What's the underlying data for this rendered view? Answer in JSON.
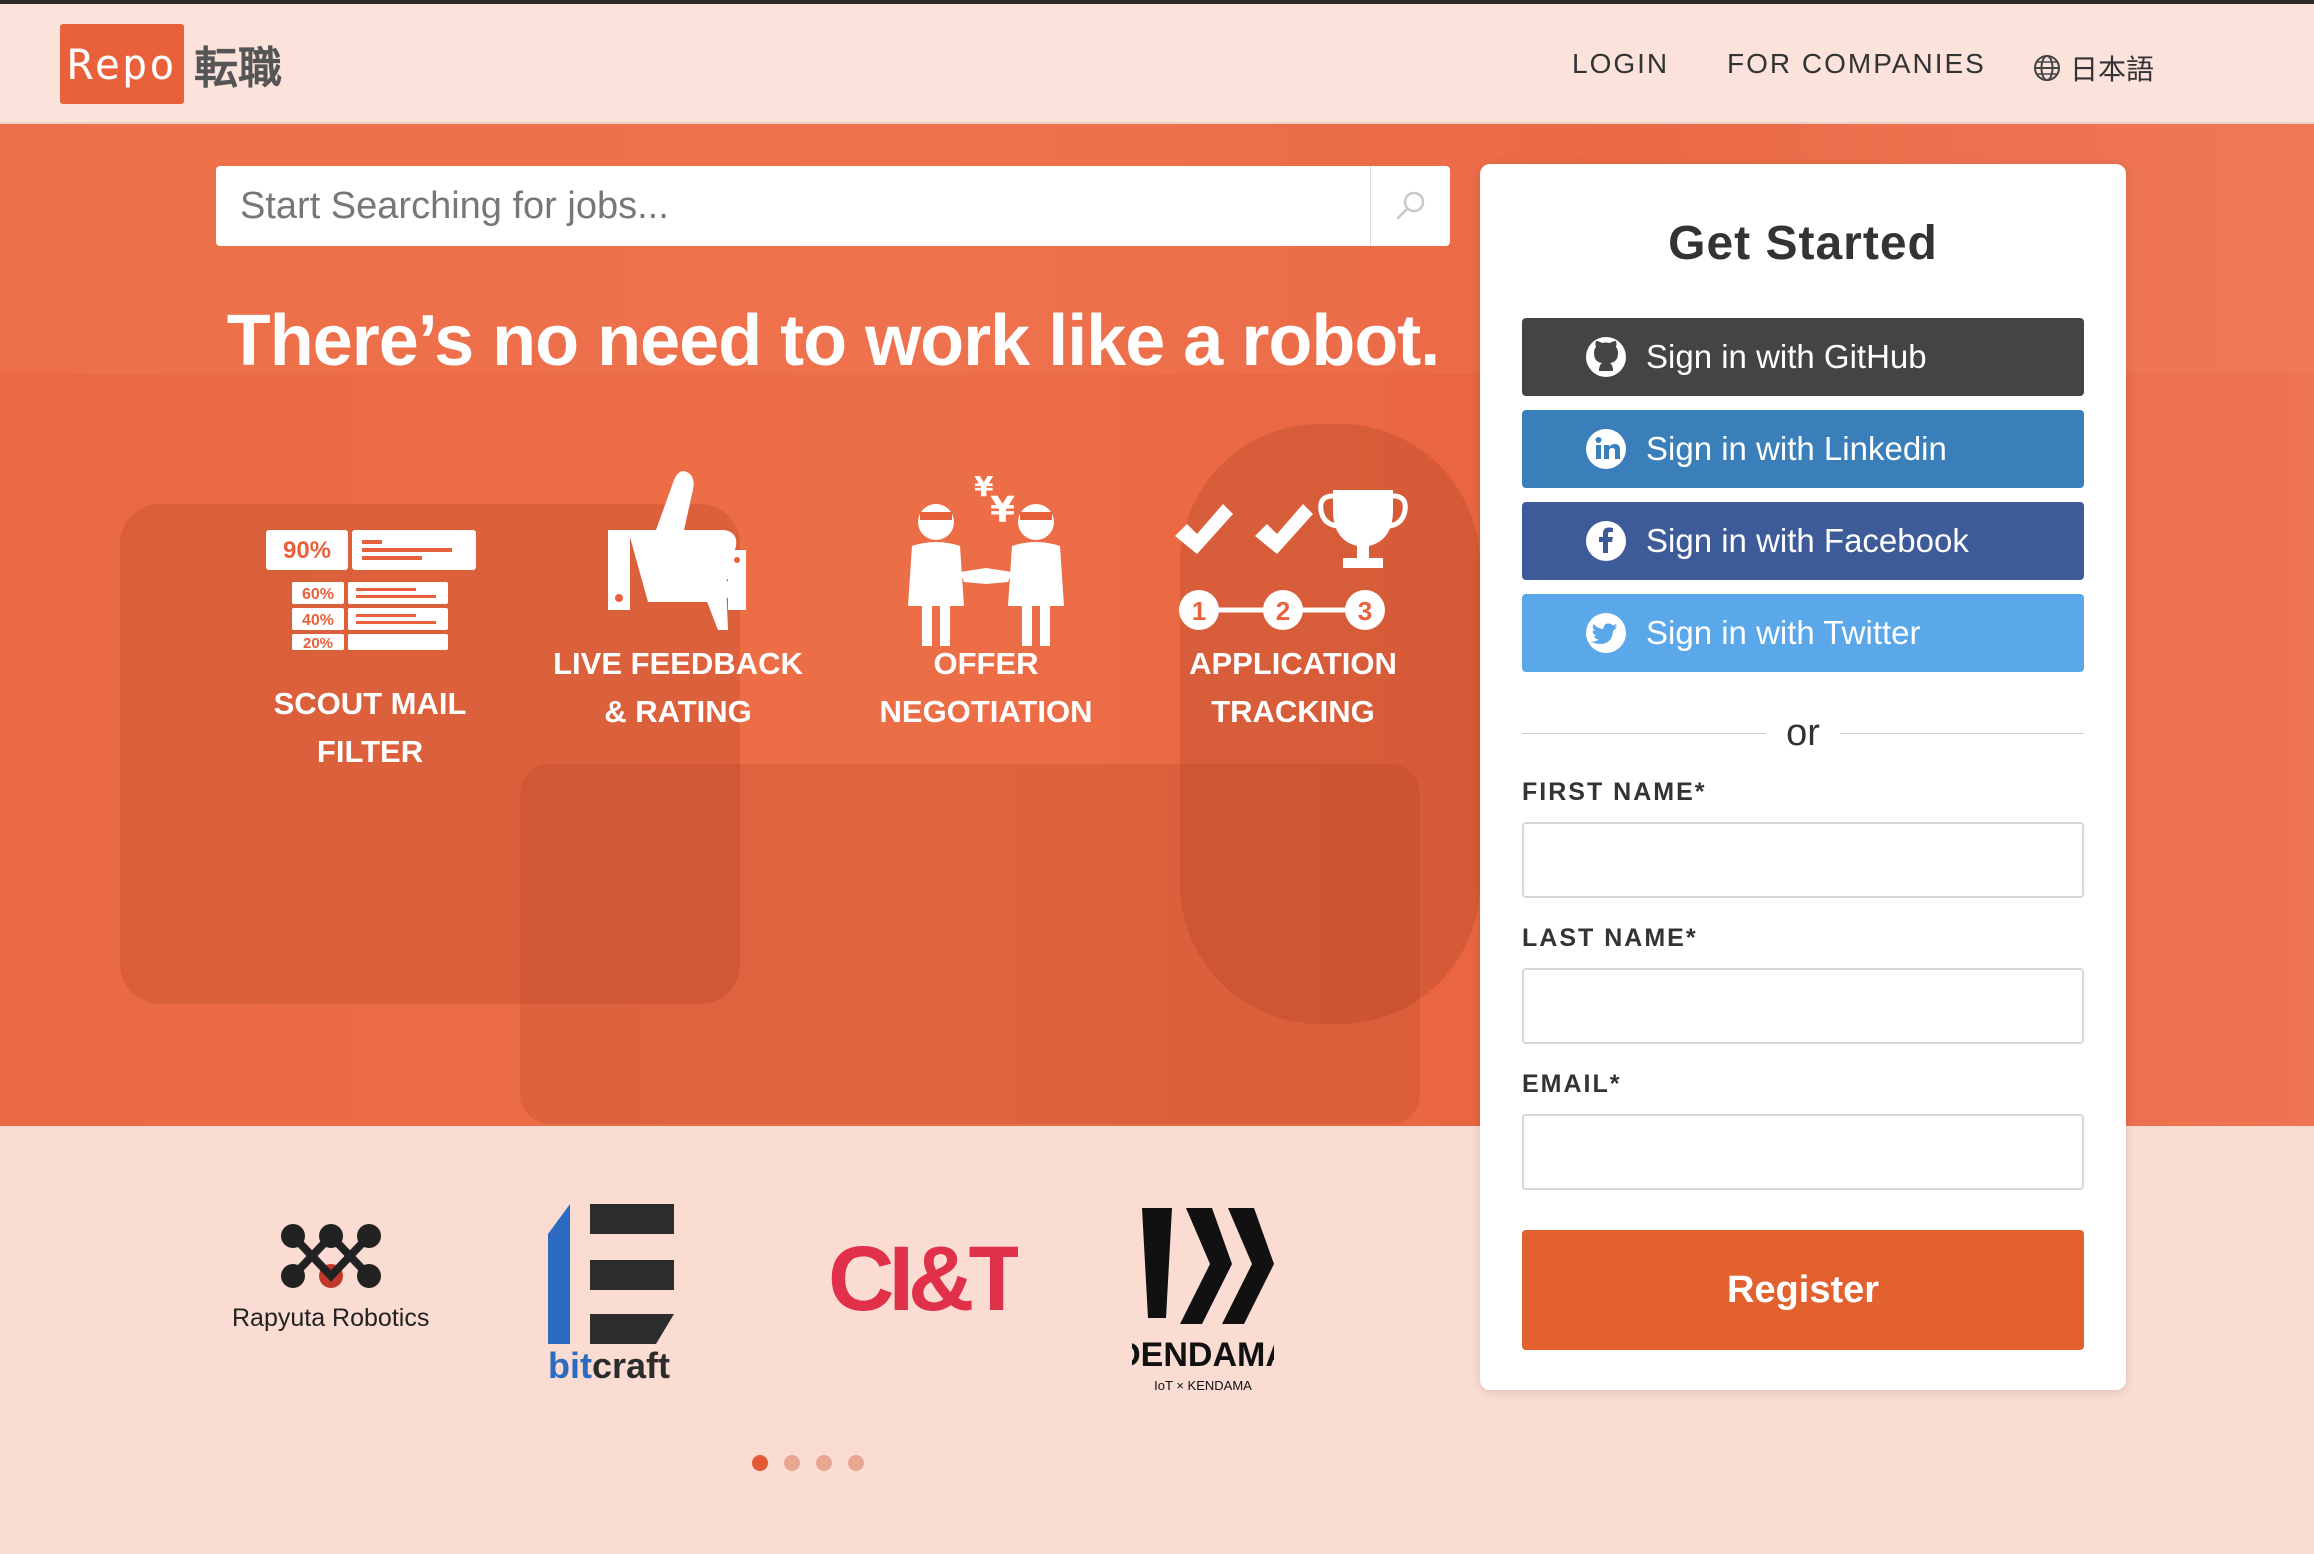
{
  "brand": {
    "logo_text": "Repo",
    "logo_suffix": "転職",
    "accent": "#e8613a"
  },
  "nav": {
    "login": "LOGIN",
    "companies": "FOR COMPANIES",
    "language": "日本語"
  },
  "search": {
    "placeholder": "Start Searching for jobs..."
  },
  "hero": {
    "headline": "There’s no need to work like a robot.",
    "features": [
      {
        "label_line1": "SCOUT MAIL",
        "label_line2": "FILTER",
        "icon": "scout-mail-filter-icon"
      },
      {
        "label_line1": "LIVE FEEDBACK",
        "label_line2": "& RATING",
        "icon": "thumbs-feedback-icon"
      },
      {
        "label_line1": "OFFER",
        "label_line2": "NEGOTIATION",
        "icon": "handshake-yen-icon"
      },
      {
        "label_line1": "APPLICATION",
        "label_line2": "TRACKING",
        "icon": "trophy-steps-icon"
      }
    ],
    "scout_percentages": [
      "90%",
      "60%",
      "40%",
      "20%"
    ],
    "steps": [
      "1",
      "2",
      "3"
    ],
    "yen_symbols": [
      "¥",
      "¥"
    ]
  },
  "clients": [
    {
      "name": "Rapyuta Robotics"
    },
    {
      "name_part1": "bit",
      "name_part2": "craft"
    },
    {
      "name": "CI&T"
    },
    {
      "name": "DENDAMA",
      "tagline": "IoT × KENDAMA"
    }
  ],
  "carousel": {
    "count": 4,
    "active": 0
  },
  "panel": {
    "title": "Get Started",
    "github": "Sign in with GitHub",
    "linkedin": "Sign in with Linkedin",
    "facebook": "Sign in with Facebook",
    "twitter": "Sign in with Twitter",
    "or": "or",
    "first_name_label": "FIRST NAME*",
    "last_name_label": "LAST NAME*",
    "email_label": "EMAIL*",
    "register": "Register"
  },
  "colors": {
    "github": "#444444",
    "linkedin": "#3a7fba",
    "facebook": "#3d5b99",
    "twitter": "#5aa7ea",
    "register": "#e3612f"
  }
}
